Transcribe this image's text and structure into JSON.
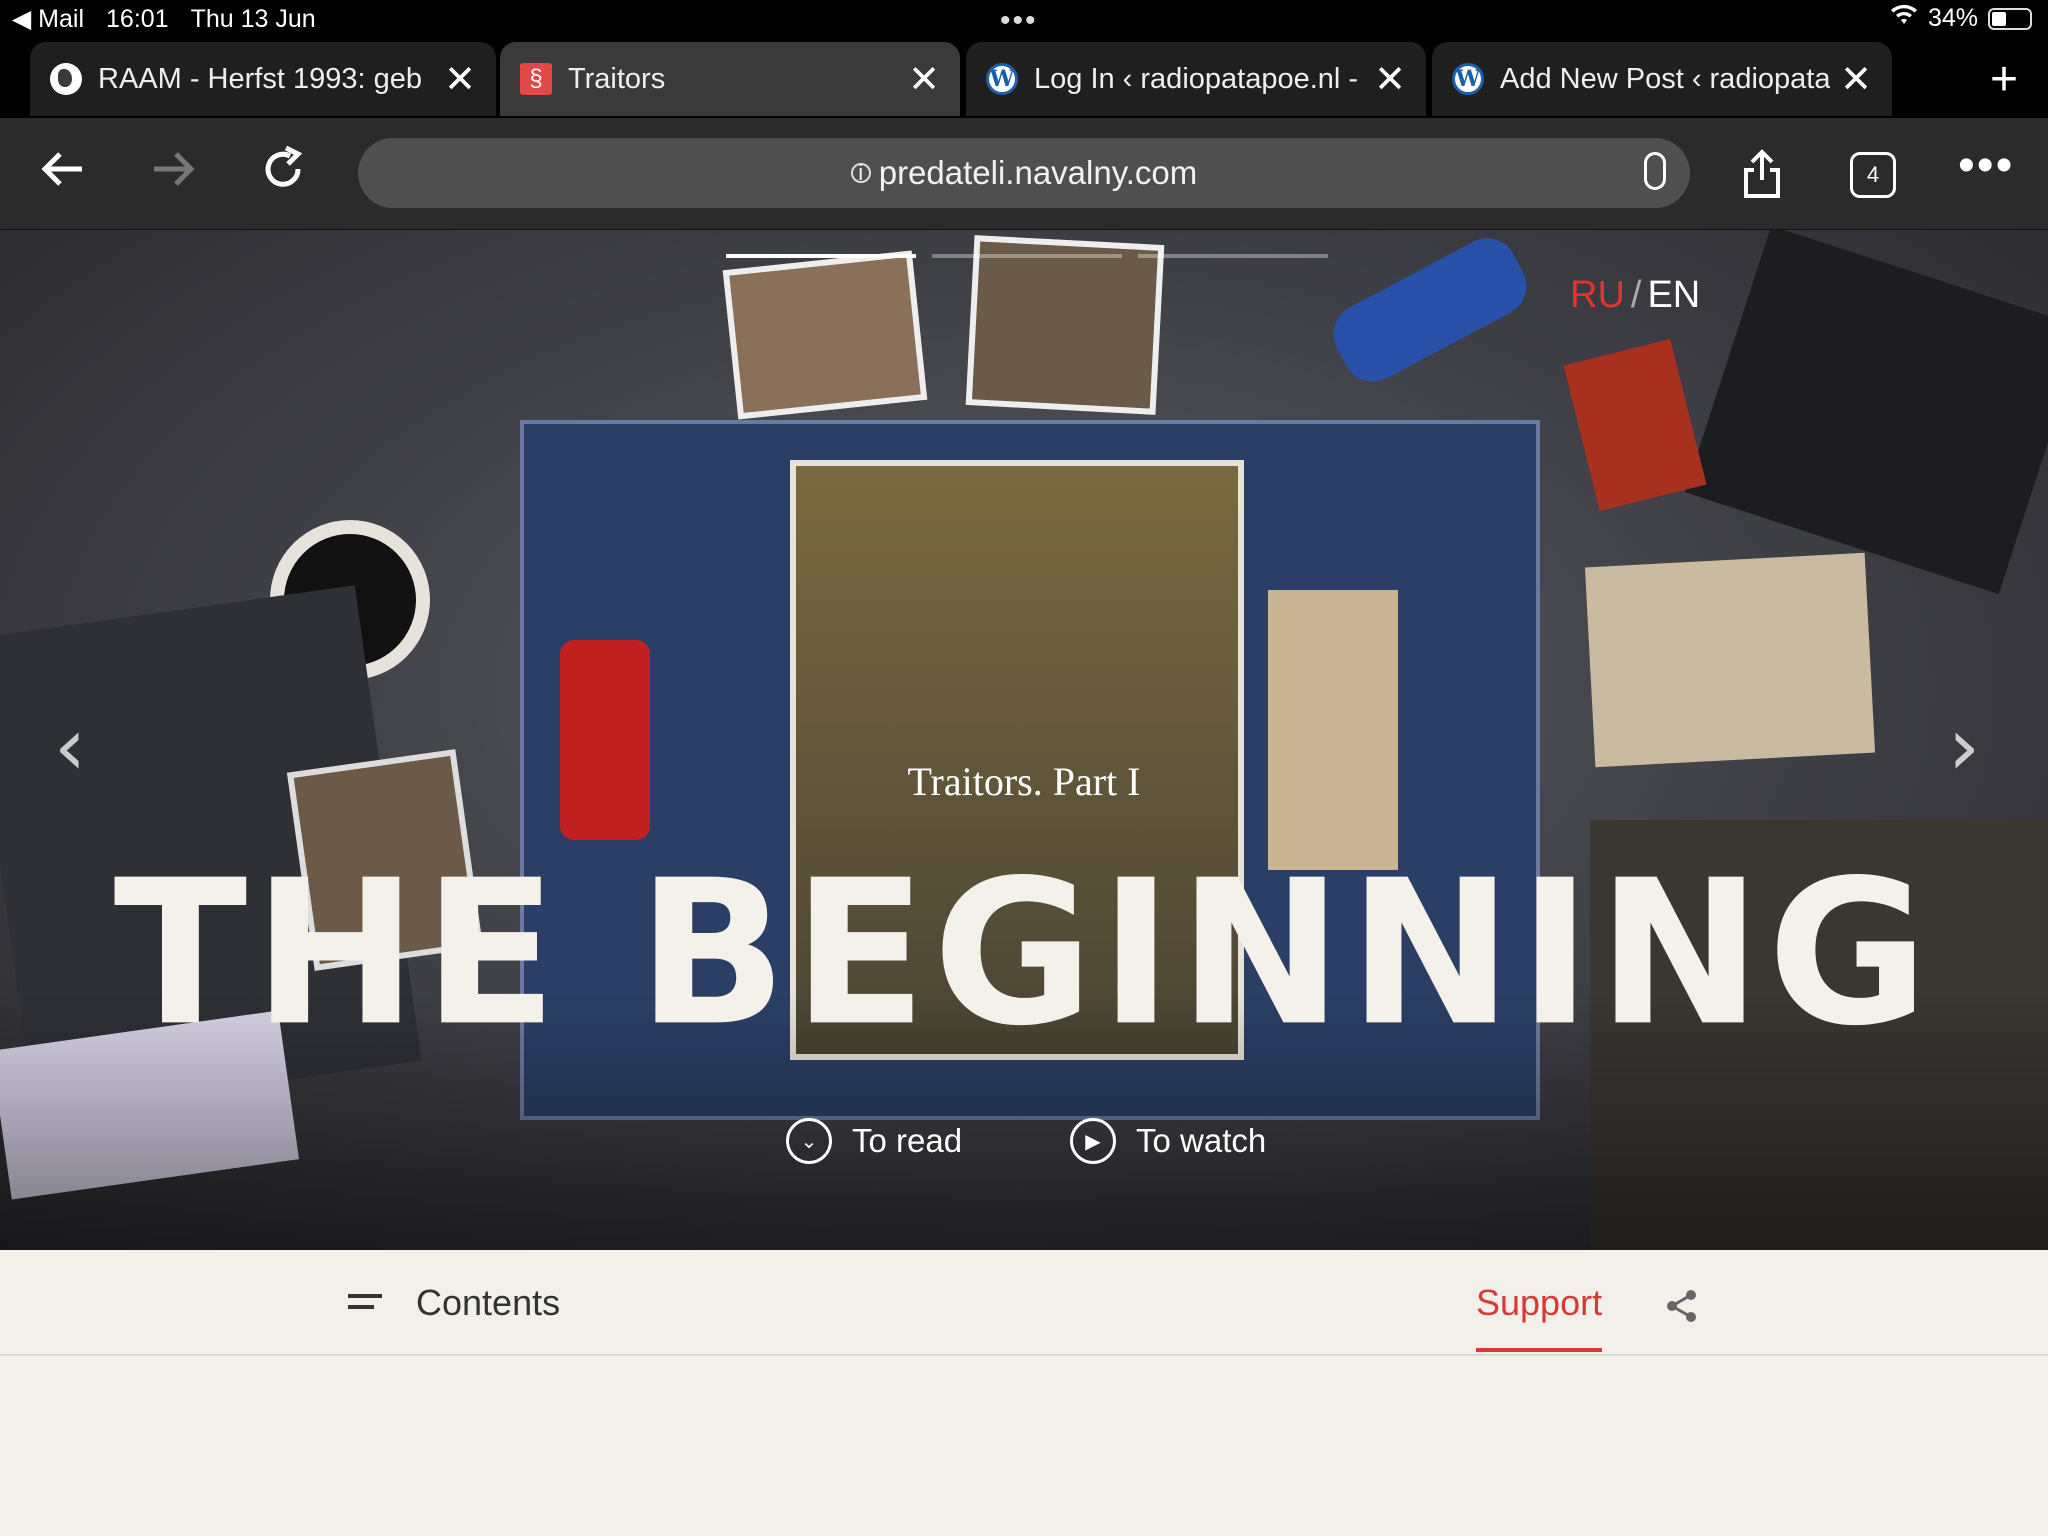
{
  "status_bar": {
    "back_app": "◀ Mail",
    "time": "16:01",
    "date": "Thu 13 Jun",
    "battery": "34%"
  },
  "tabs": [
    {
      "title": "RAAM - Herfst 1993: geb",
      "icon": "globe-icon"
    },
    {
      "title": "Traitors",
      "icon": "section-icon"
    },
    {
      "title": "Log In ‹ radiopatapoe.nl -",
      "icon": "wordpress-icon"
    },
    {
      "title": "Add New Post ‹ radiopata",
      "icon": "wordpress-icon"
    }
  ],
  "toolbar": {
    "url": "predateli.navalny.com",
    "tab_count": "4"
  },
  "hero": {
    "lang_ru": "RU",
    "lang_sep": "/",
    "lang_en": "EN",
    "subtitle": "Traitors. Part I",
    "headline": "THE BEGINNING",
    "cta_read": "To read",
    "cta_watch": "To watch"
  },
  "subnav": {
    "contents": "Contents",
    "support": "Support"
  },
  "colors": {
    "accent": "#d63a36",
    "page_bg": "#f3f0ea"
  }
}
